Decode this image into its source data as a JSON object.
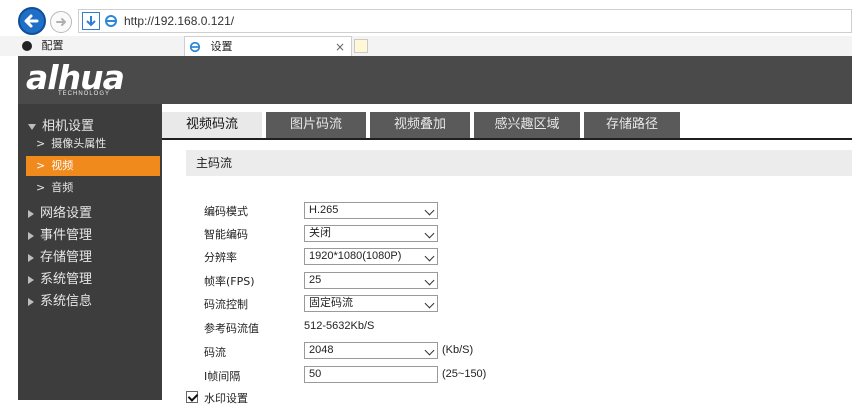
{
  "browser": {
    "url": "http://192.168.0.121/",
    "tabs": [
      {
        "label": "配置"
      },
      {
        "label": "设置",
        "close": "×"
      }
    ]
  },
  "header": {
    "logo": "alhua",
    "logo_sub": "TECHNOLOGY"
  },
  "sidebar": {
    "group_camera": "相机设置",
    "items": [
      {
        "label": "摄像头属性",
        "active": false
      },
      {
        "label": "视频",
        "active": true
      },
      {
        "label": "音频",
        "active": false
      }
    ],
    "groups": [
      "网络设置",
      "事件管理",
      "存储管理",
      "系统管理",
      "系统信息"
    ]
  },
  "content_tabs": [
    {
      "label": "视频码流",
      "active": true
    },
    {
      "label": "图片码流",
      "active": false
    },
    {
      "label": "视频叠加",
      "active": false
    },
    {
      "label": "感兴趣区域",
      "active": false
    },
    {
      "label": "存储路径",
      "active": false
    }
  ],
  "section": {
    "title": "主码流"
  },
  "form": {
    "encode_mode": {
      "label": "编码模式",
      "value": "H.265"
    },
    "smart_codec": {
      "label": "智能编码",
      "value": "关闭"
    },
    "resolution": {
      "label": "分辨率",
      "value": "1920*1080(1080P)"
    },
    "fps": {
      "label": "帧率(FPS)",
      "value": "25"
    },
    "bitrate_control": {
      "label": "码流控制",
      "value": "固定码流"
    },
    "reference_bitrate": {
      "label": "参考码流值",
      "value": "512-5632Kb/S"
    },
    "bitrate": {
      "label": "码流",
      "value": "2048",
      "unit": "(Kb/S)"
    },
    "i_frame_interval": {
      "label": "I帧间隔",
      "value": "50",
      "unit": "(25~150)"
    },
    "watermark": {
      "label": "水印设置",
      "checked": true
    }
  },
  "colors": {
    "header_bg": "#4a4a4a",
    "sidebar_bg": "#3d3d3d",
    "active_orange": "#f08a1c",
    "tab_dark": "#5a5a5a"
  }
}
